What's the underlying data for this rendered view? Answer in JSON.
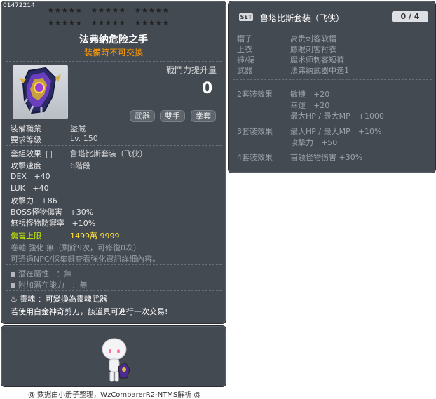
{
  "item": {
    "id": "01472214",
    "stars": [
      "★★★★★",
      "★★★★★",
      "★★★★★",
      "★★★★★",
      "★★★★★",
      "★★★★★"
    ],
    "name": "法弗纳危险之手",
    "trade_note": "装備時不可交換",
    "damage_label": "戰鬥力提升量",
    "damage_value": "0",
    "tags": [
      "武器",
      "雙手",
      "拳套"
    ],
    "job_label": "裝備職業",
    "job_value": "盜賊",
    "level_label": "要求等級",
    "level_value": "Lv. 150",
    "set_label": "套組效果",
    "set_value": "鲁塔比斯套装（飞侠）",
    "speed_label": "攻擊速度",
    "speed_value": "6階段",
    "stats": [
      {
        "name": "DEX",
        "value": "+40"
      },
      {
        "name": "LUK",
        "value": "+40"
      },
      {
        "name": "攻擊力",
        "value": "+86"
      },
      {
        "name": "BOSS怪物傷害",
        "value": "+30%"
      },
      {
        "name": "無視怪物防禦率",
        "value": "+10%"
      }
    ],
    "dmg_cap_label": "傷害上限",
    "dmg_cap_value": "1499萬 9999",
    "scroll_line": "卷軸 強化 無（剩餘9次，可修復0次）",
    "npc_line": "可透過NPC/採集鍵查看強化資訊詳細內容。",
    "potential_label": "潛在屬性",
    "potential_value": "：無",
    "add_potential_label": "附加潛在能力",
    "add_potential_value": "：無",
    "soul_label": "靈魂",
    "soul_value": "：可變換為靈魂武器",
    "scissors_line": "若使用白金神奇剪刀，該道具可進行一次交易!"
  },
  "set": {
    "badge": "SET",
    "title": "鲁塔比斯套装（飞侠）",
    "count": "0 / 4",
    "parts": [
      {
        "slot": "帽子",
        "name": "高贵刺客软帽"
      },
      {
        "slot": "上衣",
        "name": "鷹眼刺客衬衣"
      },
      {
        "slot": "褲/裙",
        "name": "魔术师刺客短裤"
      },
      {
        "slot": "武器",
        "name": "法弗纳武器中选1"
      }
    ],
    "effects": [
      {
        "label": "2套裝效果",
        "lines": [
          "敏捷　+20",
          "幸運　+20",
          "最大HP / 最大MP　+1000"
        ]
      },
      {
        "label": "3套裝效果",
        "lines": [
          "最大HP / 最大MP　+10%",
          "攻擊力　+50"
        ]
      },
      {
        "label": "4套裝效果",
        "lines": [
          "首领怪物伤害 +30%"
        ]
      }
    ]
  },
  "footer": {
    "credit": "@ 数据由小册子整理，WzComparerR2-NTMS解析 @"
  },
  "icons": {
    "weapon": "claw-weapon-icon",
    "soul": "flame-icon",
    "character": "character-preview-icon"
  }
}
